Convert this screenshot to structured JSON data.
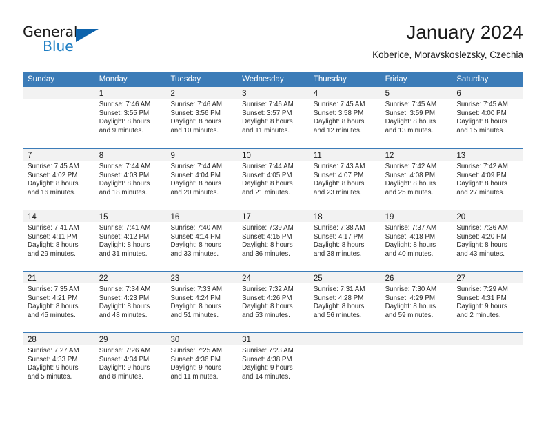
{
  "brand": {
    "name_top": "General",
    "name_bottom": "Blue",
    "accent_color": "#0d63ac",
    "text_color": "#1f7fc4"
  },
  "header": {
    "title": "January 2024",
    "subtitle": "Koberice, Moravskoslezsky, Czechia"
  },
  "theme": {
    "header_bg": "#3c7cb8",
    "day_band_bg": "#f2f2f2",
    "page_bg": "#ffffff"
  },
  "weekdays": [
    "Sunday",
    "Monday",
    "Tuesday",
    "Wednesday",
    "Thursday",
    "Friday",
    "Saturday"
  ],
  "weeks": [
    [
      {
        "day": "",
        "lines": []
      },
      {
        "day": "1",
        "lines": [
          "Sunrise: 7:46 AM",
          "Sunset: 3:55 PM",
          "Daylight: 8 hours",
          "and 9 minutes."
        ]
      },
      {
        "day": "2",
        "lines": [
          "Sunrise: 7:46 AM",
          "Sunset: 3:56 PM",
          "Daylight: 8 hours",
          "and 10 minutes."
        ]
      },
      {
        "day": "3",
        "lines": [
          "Sunrise: 7:46 AM",
          "Sunset: 3:57 PM",
          "Daylight: 8 hours",
          "and 11 minutes."
        ]
      },
      {
        "day": "4",
        "lines": [
          "Sunrise: 7:45 AM",
          "Sunset: 3:58 PM",
          "Daylight: 8 hours",
          "and 12 minutes."
        ]
      },
      {
        "day": "5",
        "lines": [
          "Sunrise: 7:45 AM",
          "Sunset: 3:59 PM",
          "Daylight: 8 hours",
          "and 13 minutes."
        ]
      },
      {
        "day": "6",
        "lines": [
          "Sunrise: 7:45 AM",
          "Sunset: 4:00 PM",
          "Daylight: 8 hours",
          "and 15 minutes."
        ]
      }
    ],
    [
      {
        "day": "7",
        "lines": [
          "Sunrise: 7:45 AM",
          "Sunset: 4:02 PM",
          "Daylight: 8 hours",
          "and 16 minutes."
        ]
      },
      {
        "day": "8",
        "lines": [
          "Sunrise: 7:44 AM",
          "Sunset: 4:03 PM",
          "Daylight: 8 hours",
          "and 18 minutes."
        ]
      },
      {
        "day": "9",
        "lines": [
          "Sunrise: 7:44 AM",
          "Sunset: 4:04 PM",
          "Daylight: 8 hours",
          "and 20 minutes."
        ]
      },
      {
        "day": "10",
        "lines": [
          "Sunrise: 7:44 AM",
          "Sunset: 4:05 PM",
          "Daylight: 8 hours",
          "and 21 minutes."
        ]
      },
      {
        "day": "11",
        "lines": [
          "Sunrise: 7:43 AM",
          "Sunset: 4:07 PM",
          "Daylight: 8 hours",
          "and 23 minutes."
        ]
      },
      {
        "day": "12",
        "lines": [
          "Sunrise: 7:42 AM",
          "Sunset: 4:08 PM",
          "Daylight: 8 hours",
          "and 25 minutes."
        ]
      },
      {
        "day": "13",
        "lines": [
          "Sunrise: 7:42 AM",
          "Sunset: 4:09 PM",
          "Daylight: 8 hours",
          "and 27 minutes."
        ]
      }
    ],
    [
      {
        "day": "14",
        "lines": [
          "Sunrise: 7:41 AM",
          "Sunset: 4:11 PM",
          "Daylight: 8 hours",
          "and 29 minutes."
        ]
      },
      {
        "day": "15",
        "lines": [
          "Sunrise: 7:41 AM",
          "Sunset: 4:12 PM",
          "Daylight: 8 hours",
          "and 31 minutes."
        ]
      },
      {
        "day": "16",
        "lines": [
          "Sunrise: 7:40 AM",
          "Sunset: 4:14 PM",
          "Daylight: 8 hours",
          "and 33 minutes."
        ]
      },
      {
        "day": "17",
        "lines": [
          "Sunrise: 7:39 AM",
          "Sunset: 4:15 PM",
          "Daylight: 8 hours",
          "and 36 minutes."
        ]
      },
      {
        "day": "18",
        "lines": [
          "Sunrise: 7:38 AM",
          "Sunset: 4:17 PM",
          "Daylight: 8 hours",
          "and 38 minutes."
        ]
      },
      {
        "day": "19",
        "lines": [
          "Sunrise: 7:37 AM",
          "Sunset: 4:18 PM",
          "Daylight: 8 hours",
          "and 40 minutes."
        ]
      },
      {
        "day": "20",
        "lines": [
          "Sunrise: 7:36 AM",
          "Sunset: 4:20 PM",
          "Daylight: 8 hours",
          "and 43 minutes."
        ]
      }
    ],
    [
      {
        "day": "21",
        "lines": [
          "Sunrise: 7:35 AM",
          "Sunset: 4:21 PM",
          "Daylight: 8 hours",
          "and 45 minutes."
        ]
      },
      {
        "day": "22",
        "lines": [
          "Sunrise: 7:34 AM",
          "Sunset: 4:23 PM",
          "Daylight: 8 hours",
          "and 48 minutes."
        ]
      },
      {
        "day": "23",
        "lines": [
          "Sunrise: 7:33 AM",
          "Sunset: 4:24 PM",
          "Daylight: 8 hours",
          "and 51 minutes."
        ]
      },
      {
        "day": "24",
        "lines": [
          "Sunrise: 7:32 AM",
          "Sunset: 4:26 PM",
          "Daylight: 8 hours",
          "and 53 minutes."
        ]
      },
      {
        "day": "25",
        "lines": [
          "Sunrise: 7:31 AM",
          "Sunset: 4:28 PM",
          "Daylight: 8 hours",
          "and 56 minutes."
        ]
      },
      {
        "day": "26",
        "lines": [
          "Sunrise: 7:30 AM",
          "Sunset: 4:29 PM",
          "Daylight: 8 hours",
          "and 59 minutes."
        ]
      },
      {
        "day": "27",
        "lines": [
          "Sunrise: 7:29 AM",
          "Sunset: 4:31 PM",
          "Daylight: 9 hours",
          "and 2 minutes."
        ]
      }
    ],
    [
      {
        "day": "28",
        "lines": [
          "Sunrise: 7:27 AM",
          "Sunset: 4:33 PM",
          "Daylight: 9 hours",
          "and 5 minutes."
        ]
      },
      {
        "day": "29",
        "lines": [
          "Sunrise: 7:26 AM",
          "Sunset: 4:34 PM",
          "Daylight: 9 hours",
          "and 8 minutes."
        ]
      },
      {
        "day": "30",
        "lines": [
          "Sunrise: 7:25 AM",
          "Sunset: 4:36 PM",
          "Daylight: 9 hours",
          "and 11 minutes."
        ]
      },
      {
        "day": "31",
        "lines": [
          "Sunrise: 7:23 AM",
          "Sunset: 4:38 PM",
          "Daylight: 9 hours",
          "and 14 minutes."
        ]
      },
      {
        "day": "",
        "lines": []
      },
      {
        "day": "",
        "lines": []
      },
      {
        "day": "",
        "lines": []
      }
    ]
  ]
}
